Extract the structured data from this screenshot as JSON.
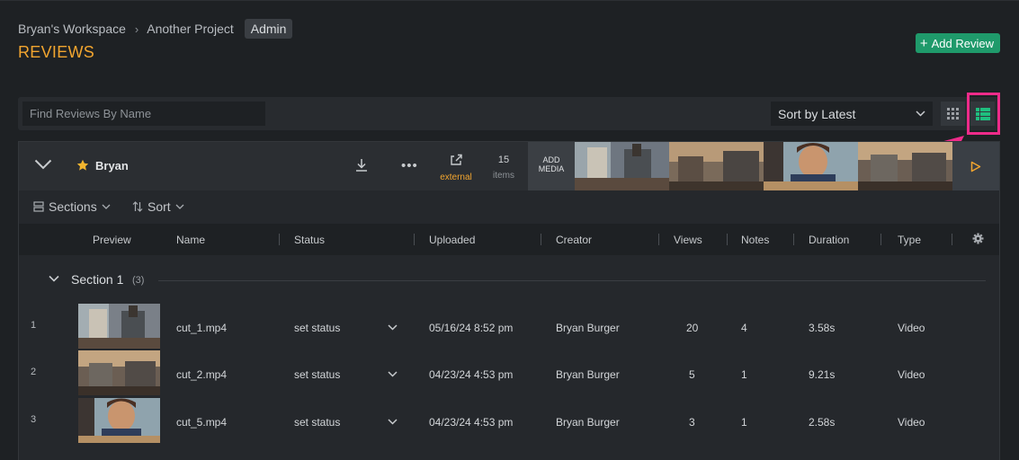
{
  "header": {
    "breadcrumb": [
      "Bryan's Workspace",
      "Another Project"
    ],
    "role_badge": "Admin",
    "title": "REVIEWS",
    "add_review_label": "Add Review"
  },
  "toolbar": {
    "search_placeholder": "Find Reviews By Name",
    "sort_label": "Sort by Latest",
    "view_modes": [
      "grid-view-icon",
      "list-view-icon"
    ],
    "active_view": "list"
  },
  "group": {
    "name": "Bryan",
    "share_label": "external",
    "items_count": "15",
    "items_label": "items",
    "add_media_line1": "ADD",
    "add_media_line2": "MEDIA",
    "sections_label": "Sections",
    "sort_label": "Sort"
  },
  "table": {
    "columns": [
      "Preview",
      "Name",
      "Status",
      "Uploaded",
      "Creator",
      "Views",
      "Notes",
      "Duration",
      "Type"
    ],
    "section": {
      "label": "Section 1",
      "count": "(3)"
    },
    "rows": [
      {
        "index": "1",
        "name": "cut_1.mp4",
        "status": "set status",
        "uploaded": "05/16/24 8:52 pm",
        "creator": "Bryan Burger",
        "views": "20",
        "notes": "4",
        "duration": "3.58s",
        "type": "Video"
      },
      {
        "index": "2",
        "name": "cut_2.mp4",
        "status": "set status",
        "uploaded": "04/23/24 4:53 pm",
        "creator": "Bryan Burger",
        "views": "5",
        "notes": "1",
        "duration": "9.21s",
        "type": "Video"
      },
      {
        "index": "3",
        "name": "cut_5.mp4",
        "status": "set status",
        "uploaded": "04/23/24 4:53 pm",
        "creator": "Bryan Burger",
        "views": "3",
        "notes": "1",
        "duration": "2.58s",
        "type": "Video"
      }
    ]
  },
  "colors": {
    "accent": "#f2a52f",
    "brand_green": "#1f9a6b",
    "highlight": "#ee2b8a",
    "background": "#1e2124"
  }
}
